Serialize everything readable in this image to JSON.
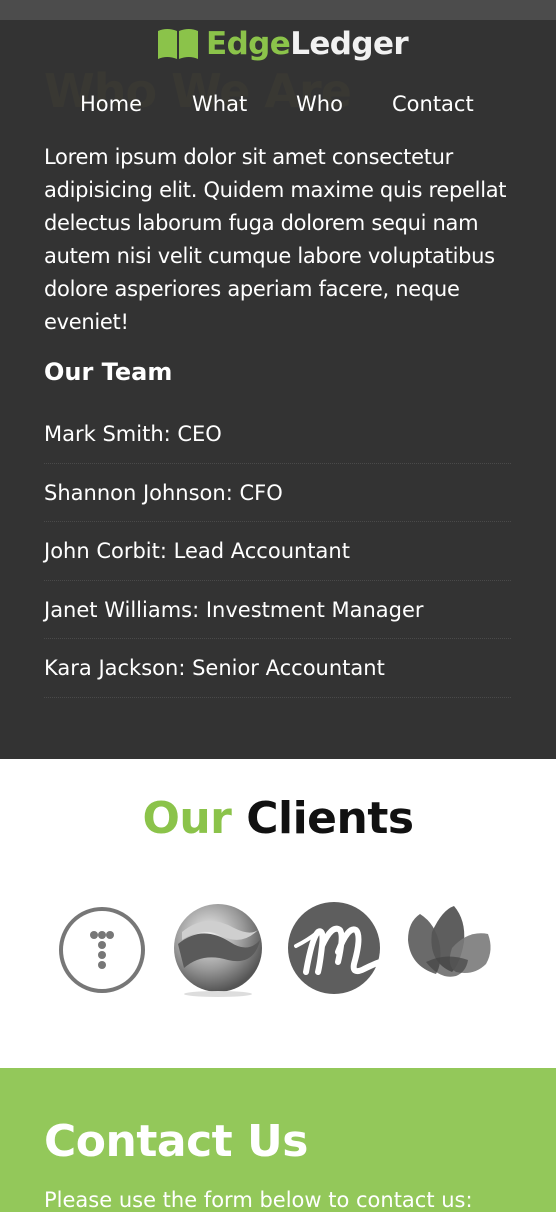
{
  "header": {
    "logo": {
      "icon": "open-book-icon",
      "part1": "Edge",
      "part2": "Ledger"
    },
    "nav": [
      {
        "label": "Home"
      },
      {
        "label": "What"
      },
      {
        "label": "Who"
      },
      {
        "label": "Contact"
      }
    ]
  },
  "who": {
    "heading": "Who We Are",
    "body": "Lorem ipsum dolor sit amet consectetur adipisicing elit. Quidem maxime quis repellat delectus laborum fuga dolorem sequi nam autem nisi velit cumque labore voluptatibus dolore asperiores aperiam facere, neque eveniet!",
    "team_heading": "Our Team",
    "team": [
      "Mark Smith: CEO",
      "Shannon Johnson: CFO",
      "John Corbit: Lead Accountant",
      "Janet Williams: Investment Manager",
      "Kara Jackson: Senior Accountant"
    ]
  },
  "clients": {
    "heading_accent": "Our",
    "heading_rest": "Clients",
    "logos": [
      "t-dots-logo-icon",
      "swirl-sphere-logo-icon",
      "m-script-logo-icon",
      "leaves-logo-icon"
    ]
  },
  "contact": {
    "heading": "Contact Us",
    "text": "Please use the form below to contact us:"
  },
  "colors": {
    "accent": "#8bc34a",
    "dark_bg": "#333333",
    "contact_bg": "#93c85a"
  }
}
